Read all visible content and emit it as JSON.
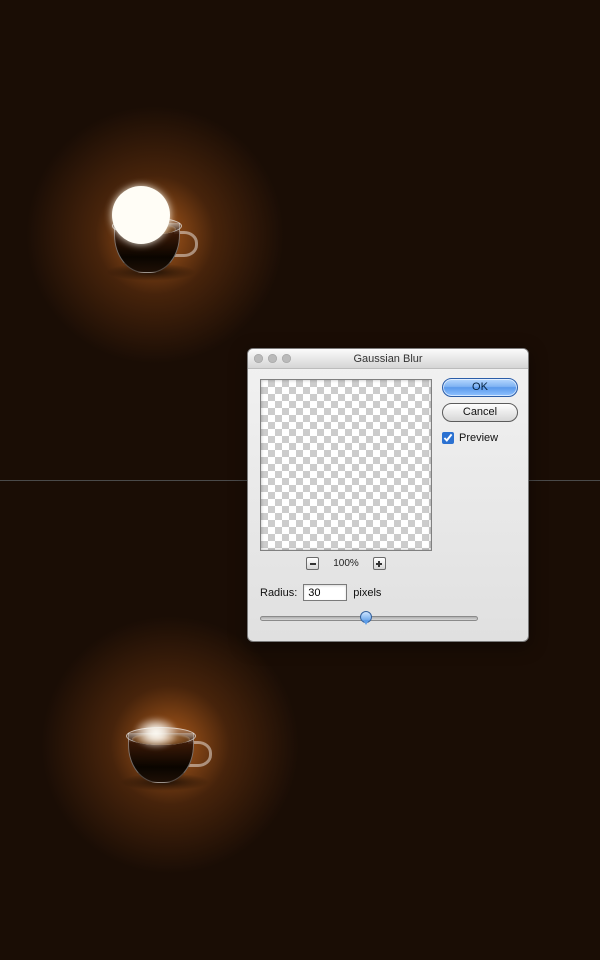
{
  "dialog": {
    "title": "Gaussian Blur",
    "ok": "OK",
    "cancel": "Cancel",
    "preview_label": "Preview",
    "preview_checked": true,
    "zoom_label": "100%",
    "radius_label": "Radius:",
    "radius_unit": "pixels",
    "radius_value": "30",
    "slider_percent": 48
  }
}
